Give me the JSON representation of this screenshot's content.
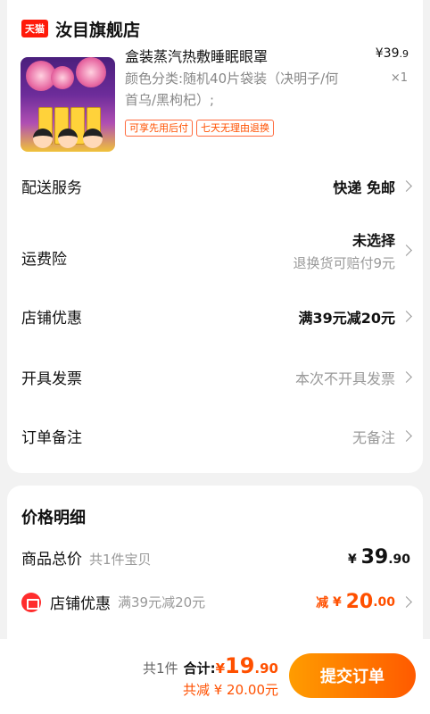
{
  "shop": {
    "badge": "天猫",
    "name": "汝目旗舰店"
  },
  "product": {
    "title": "盒装蒸汽热敷睡眠眼罩",
    "price_currency": "¥",
    "price_int": "39",
    "price_dec": ".9",
    "qty": "×1",
    "spec": "颜色分类:随机40片袋装（决明子/何首乌/黑枸杞）;",
    "tags": [
      "可享先用后付",
      "七天无理由退换"
    ]
  },
  "rows": {
    "delivery": {
      "label": "配送服务",
      "value": "快递 免邮"
    },
    "insurance": {
      "label": "运费险",
      "value1": "未选择",
      "value2": "退换货可赔付9元"
    },
    "discount": {
      "label": "店铺优惠",
      "value": "满39元减20元"
    },
    "invoice": {
      "label": "开具发票",
      "value": "本次不开具发票"
    },
    "note": {
      "label": "订单备注",
      "value": "无备注"
    }
  },
  "price_detail": {
    "title": "价格明细",
    "total_label": "商品总价",
    "total_sub": "共1件宝贝",
    "total_cur": "¥",
    "total_int": "39",
    "total_dec": ".90",
    "shop_discount_label": "店铺优惠",
    "shop_discount_sub": "满39元减20元",
    "discount_prefix": "减",
    "discount_cur": "¥",
    "discount_int": "20",
    "discount_dec": ".00"
  },
  "bottom": {
    "count": "共1件",
    "total_label": "合计:",
    "cur": "¥",
    "int": "19",
    "dec": ".90",
    "saved": "共减 ¥ 20.00元",
    "submit": "提交订单"
  },
  "colors": {
    "accent": "#ff5000",
    "tmall": "#ff1a0a"
  }
}
